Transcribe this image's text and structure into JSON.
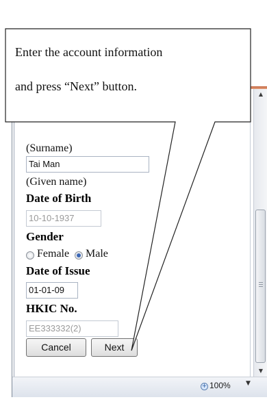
{
  "callout": {
    "line1": "Enter the account information",
    "line2": "and press “Next” button."
  },
  "form": {
    "surname_caption": "(Surname)",
    "given_name_value": "Tai Man",
    "given_name_caption": "(Given name)",
    "dob_label": "Date of Birth",
    "dob_value": "10-10-1937",
    "gender_label": "Gender",
    "gender_options": [
      "Female",
      "Male"
    ],
    "gender_selected": "Male",
    "doi_label": "Date of Issue",
    "doi_value": "01-01-09",
    "hkic_label": "HKIC No.",
    "hkic_value": "EE333332(2)",
    "cancel_label": "Cancel",
    "next_label": "Next"
  },
  "statusbar": {
    "zoom_level": "100%",
    "zoom_icon": "zoom-in-icon",
    "dropdown_icon": "chevron-down-icon"
  },
  "scrollbar": {
    "up_icon": "scroll-up-arrow-icon",
    "down_icon": "scroll-down-arrow-icon"
  },
  "colors": {
    "window_accent": "#c56a45",
    "radio_selected": "#3c67b5"
  }
}
